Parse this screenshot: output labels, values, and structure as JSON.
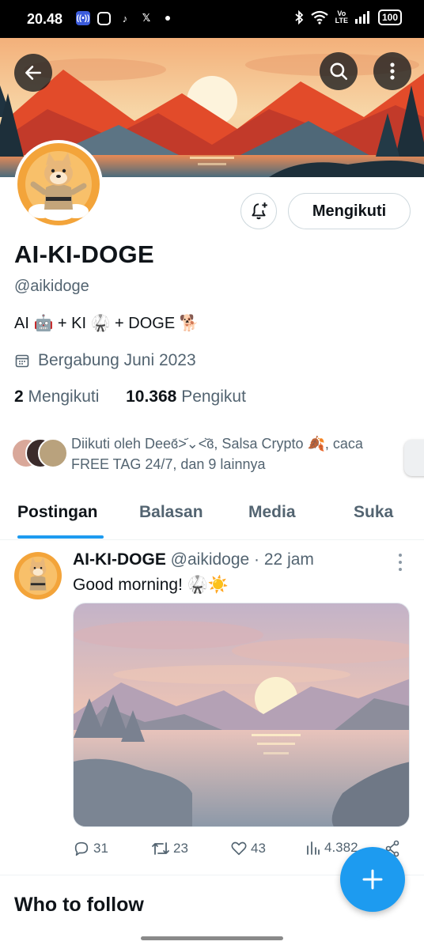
{
  "status_bar": {
    "time": "20.48",
    "battery": "100"
  },
  "profile": {
    "name": "AI-KI-DOGE",
    "handle": "@aikidoge",
    "bio": "AI 🤖 + KI 🥋 + DOGE 🐕",
    "joined": "Bergabung Juni 2023",
    "following_count": "2",
    "following_label": "Mengikuti",
    "followers_count": "10.368",
    "followers_label": "Pengikut",
    "follow_button": "Mengikuti",
    "followed_by": "Diikuti oleh Deeɞ᷄˃᷄⌄˂᷅ɞ᷅, Salsa Crypto 🍂, caca FREE TAG 24/7, dan 9 lainnya"
  },
  "tabs": [
    "Postingan",
    "Balasan",
    "Media",
    "Suka"
  ],
  "post": {
    "author": "AI-KI-DOGE",
    "handle_time": "@aikidoge · 22 jam",
    "text": "Good morning! 🥋☀️",
    "replies": "31",
    "reposts": "23",
    "likes": "43",
    "views": "4.382"
  },
  "who_to_follow": "Who to follow",
  "icons": [
    "back-arrow-icon",
    "search-icon",
    "more-vertical-icon",
    "bell-plus-icon",
    "calendar-icon",
    "reply-icon",
    "repost-icon",
    "heart-icon",
    "views-icon",
    "share-icon",
    "plus-icon"
  ],
  "colors": {
    "accent": "#1d9bf0",
    "text": "#0f1419",
    "muted": "#536471"
  }
}
